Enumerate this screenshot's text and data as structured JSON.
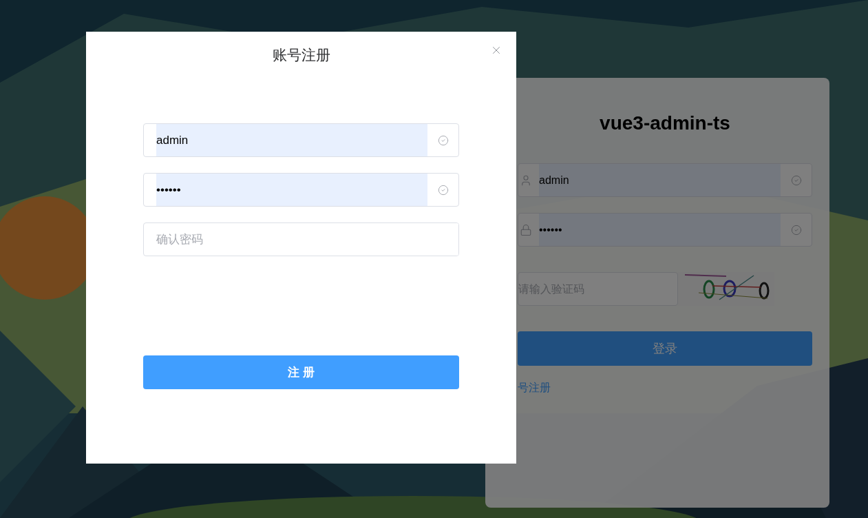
{
  "login_panel": {
    "title": "vue3-admin-ts",
    "fields": [
      {
        "kind": "username",
        "value": "admin",
        "valid": true
      },
      {
        "kind": "password",
        "value": "••••••",
        "valid": true
      }
    ],
    "captcha": {
      "placeholder": "请输入验证码"
    },
    "login_button": "登录",
    "register_link": "号注册"
  },
  "register_dialog": {
    "title": "账号注册",
    "fields": [
      {
        "value": "admin",
        "autofilled": true,
        "valid": true
      },
      {
        "value": "••••••",
        "autofilled": true,
        "valid": true
      },
      {
        "placeholder": "确认密码",
        "autofilled": false,
        "valid": false
      }
    ],
    "submit": "注 册"
  }
}
